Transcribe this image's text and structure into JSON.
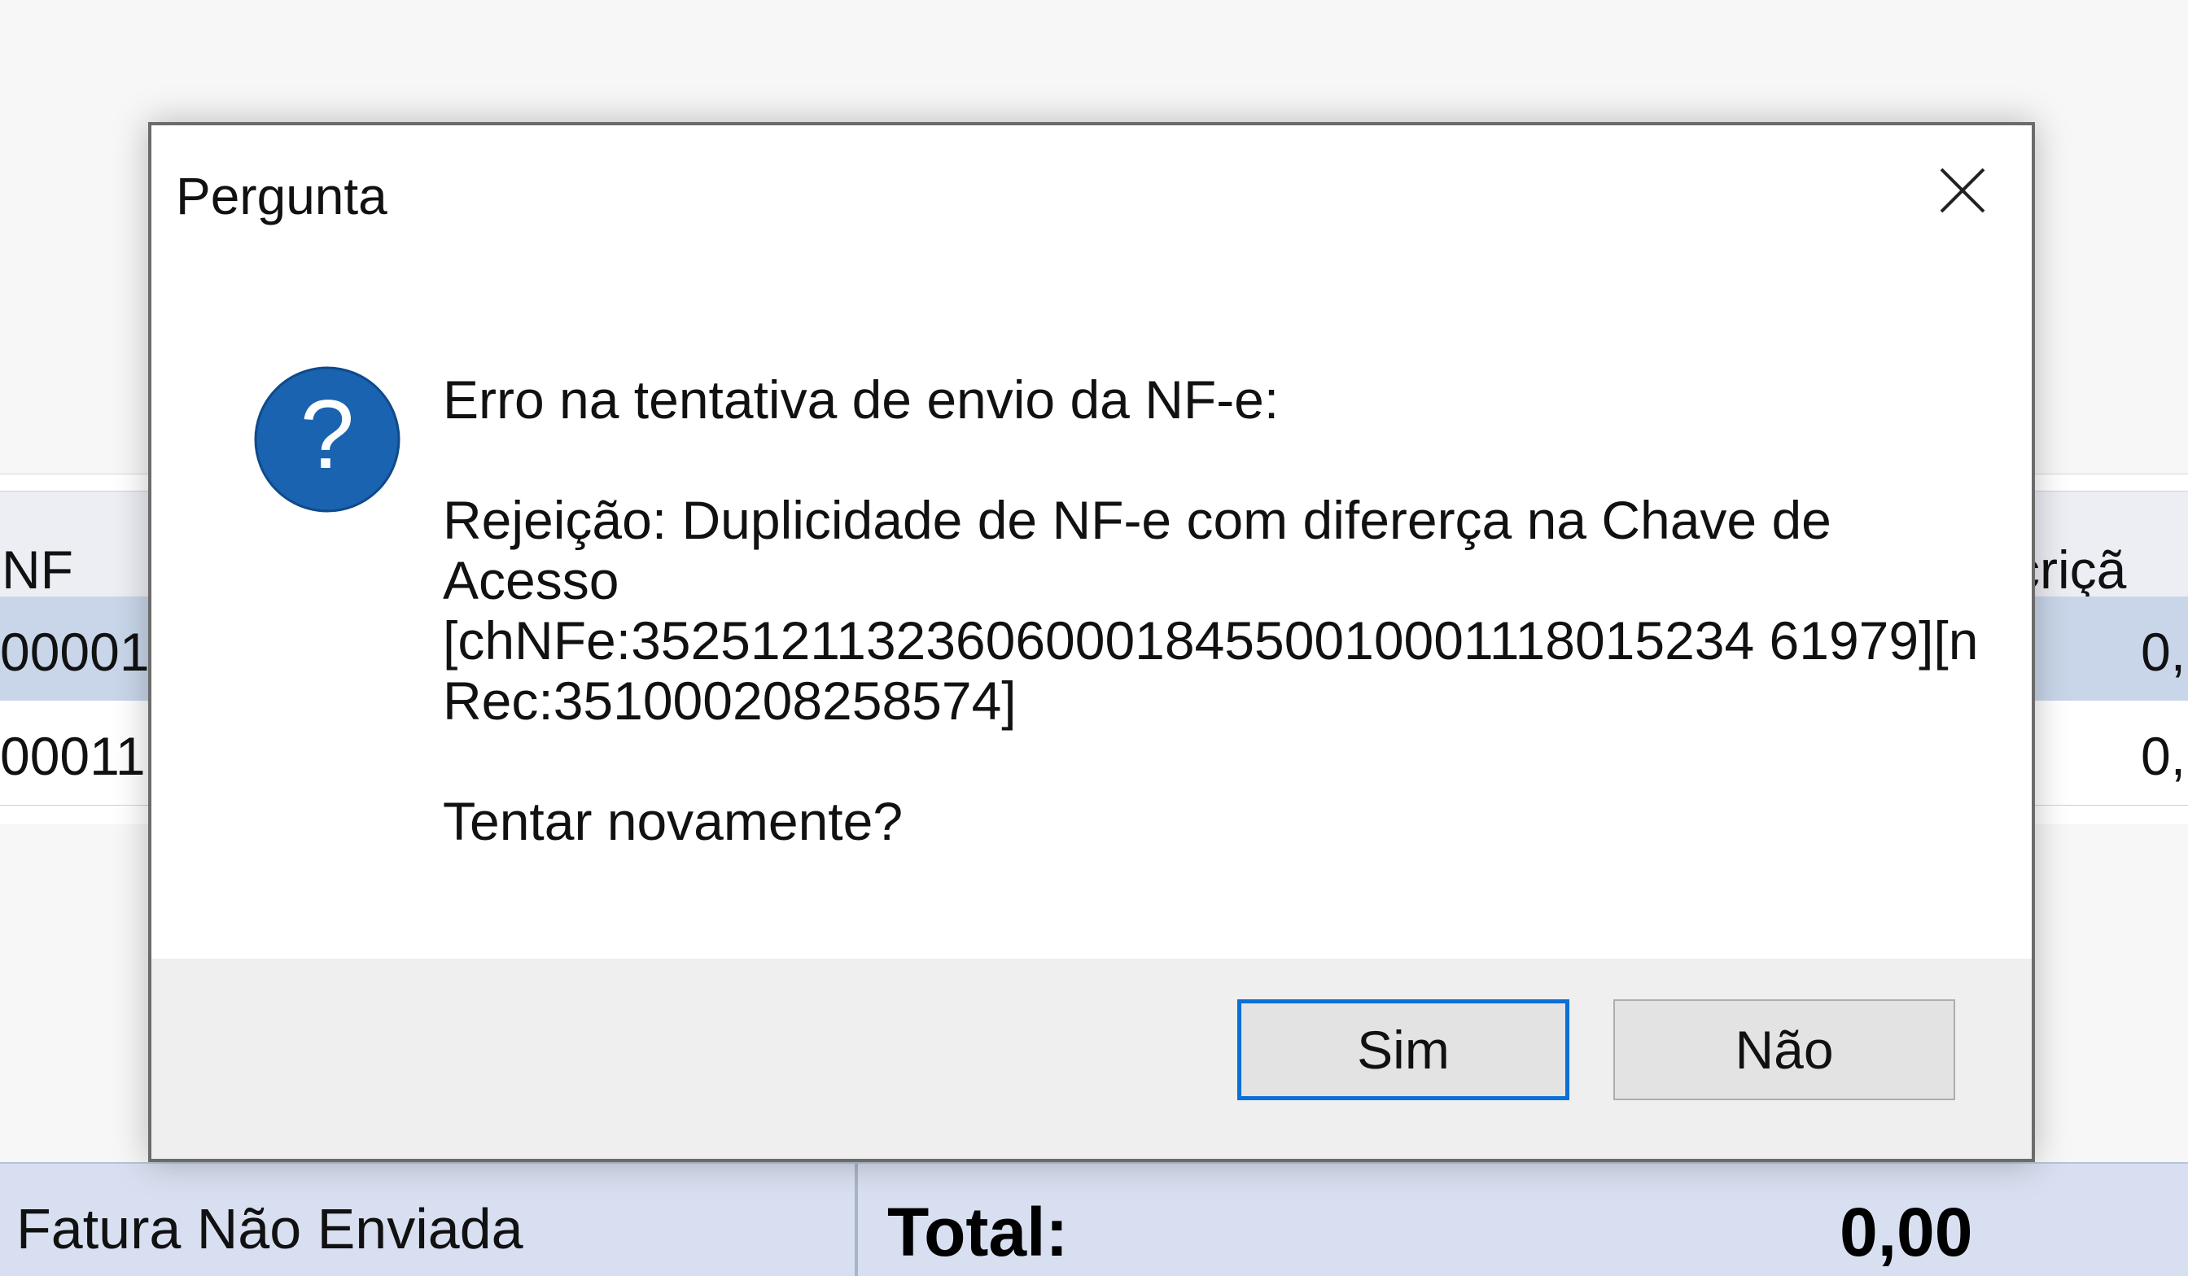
{
  "background_grid": {
    "header_nf": "NF",
    "header_desc": "scriçã",
    "rows": [
      {
        "nf": "00001",
        "value": "0,"
      },
      {
        "nf": "00011",
        "value": "0,"
      }
    ]
  },
  "status_bar": {
    "status_text": "Fatura Não Enviada",
    "total_label": "Total:",
    "total_value": "0,00"
  },
  "dialog": {
    "title": "Pergunta",
    "close_icon": "close-icon",
    "question_icon": "question-icon",
    "message_line1": "Erro na tentativa de envio da NF-e:",
    "message_line2": "Rejeição: Duplicidade de NF-e com difererça na Chave de",
    "message_line3": "Acesso",
    "message_line4": "[chNFe:35251211323606000184550010001118015234 61979][n",
    "message_line5": "Rec:351000208258574]",
    "message_line6": "Tentar novamente?",
    "buttons": {
      "yes": "Sim",
      "no": "Não"
    }
  },
  "colors": {
    "accent": "#0a6fd6",
    "icon_blue": "#1a63b0",
    "selected_row": "#c9d6ea",
    "status_bar": "#d8dff0"
  }
}
